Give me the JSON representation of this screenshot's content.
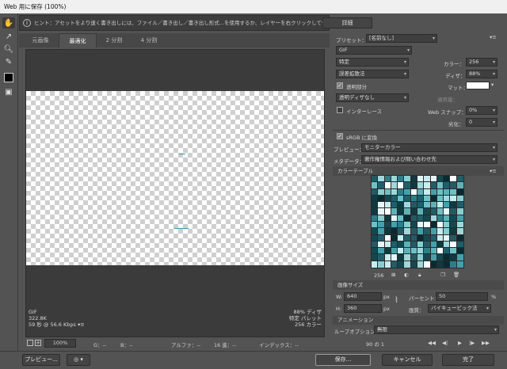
{
  "window": {
    "title": "Web 用に保存 (100%)"
  },
  "hint": {
    "text": "ヒント：アセットをより速く書き出しには、ファイル／書き出し／書き出し形式...を使用するか、レイヤーを右クリックして使用。",
    "details_label": "詳細"
  },
  "tabs": [
    {
      "label": "元画像"
    },
    {
      "label": "最適化"
    },
    {
      "label": "2 分割"
    },
    {
      "label": "4 分割"
    }
  ],
  "preview_info": {
    "format": "GIF",
    "size": "322.8K",
    "time": "59 秒 @ 56.6 Kbps",
    "time_arrow": "▾≡",
    "dither": "88% ディザ",
    "palette": "特定 パレット",
    "colors": "256 カラー"
  },
  "status": {
    "zoom": "100%",
    "g": "G：--",
    "b": "B：--",
    "alpha": "アルファ：--",
    "hex": "16 進：--",
    "index": "インデックス：--"
  },
  "bottom": {
    "preview_label": "プレビュー...",
    "save_label": "保存...",
    "cancel_label": "キャンセル",
    "done_label": "完了"
  },
  "panel": {
    "preset_label": "プリセット：",
    "preset_value": "[名前なし]",
    "format_value": "GIF",
    "reduction_value": "特定",
    "dither_algo_value": "誤差拡散法",
    "transparency_label": "透明部分",
    "transparency_dither_value": "透明ディザなし",
    "interlace_label": "インターレース",
    "colors_label": "カラー：",
    "colors_value": "256",
    "dither_label": "ディザ：",
    "dither_value": "88%",
    "matte_label": "マット：",
    "amount_label": "適用量：",
    "websnap_label": "Web スナップ：",
    "websnap_value": "0%",
    "lossy_label": "劣化：",
    "lossy_value": "0",
    "srgb_label": "sRGB に変換",
    "preview_label": "プレビュー：",
    "preview_value": "モニターカラー",
    "metadata_label": "メタデータ：",
    "metadata_value": "著作権情報および問い合わせ先",
    "color_table_label": "カラーテーブル",
    "color_count": "256",
    "image_size_label": "画像サイズ",
    "w_label": "W:",
    "w_value": "640",
    "h_label": "H:",
    "h_value": "360",
    "px": "px",
    "percent_label": "パーセント：",
    "percent_value": "50",
    "percent_unit": "%",
    "quality_label": "画質：",
    "quality_value": "バイキュービック法",
    "animation_label": "アニメーション",
    "loop_label": "ループオプション：",
    "loop_value": "無限",
    "frame_counter": "90 の 1"
  },
  "colors": {
    "accent": "#2aa6b5",
    "swatch_palette": [
      "#0e3a40",
      "#1d5f6a",
      "#2c7f8a",
      "#3fa3ad",
      "#6cc1c7",
      "#9fd8da",
      "#c9ecec",
      "#e8f7f6",
      "#14484f",
      "#5bb3b8",
      "#255964",
      "#86cfd0",
      "#ffffff",
      "#0a2a30"
    ]
  }
}
